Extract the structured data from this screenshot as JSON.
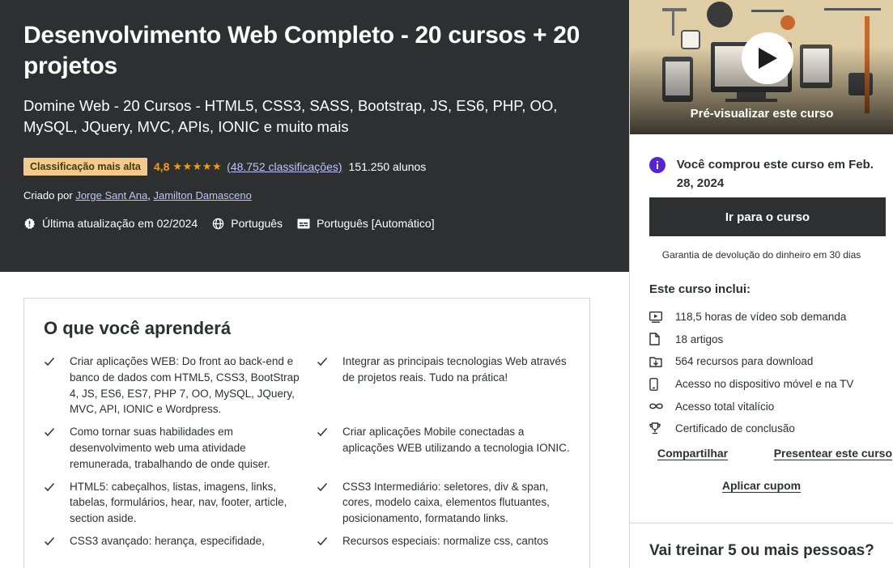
{
  "course": {
    "title": "Desenvolvimento Web Completo - 20 cursos + 20 projetos",
    "subtitle": "Domine Web - 20 Cursos - HTML5, CSS3, SASS, Bootstrap, JS, ES6, PHP, OO, MySQL, JQuery, MVC, APIs, IONIC e muito mais",
    "badge": "Classificação mais alta",
    "rating": "4,8",
    "stars": "★★★★★",
    "rating_count": "(48.752 classificações)",
    "students": "151.250 alunos",
    "created_by_label": "Criado por",
    "creators": [
      "Jorge Sant Ana",
      "Jamilton Damasceno"
    ],
    "creator_separator": ", ",
    "last_updated": "Última atualização em 02/2024",
    "language": "Português",
    "captions": "Português [Automático]"
  },
  "learn": {
    "title": "O que você aprenderá",
    "items": [
      "Criar aplicações WEB: Do front ao back-end e banco de dados com HTML5, CSS3, BootStrap 4, JS, ES6, ES7, PHP 7, OO, MySQL, JQuery, MVC, API, IONIC e Wordpress.",
      "Integrar as principais tecnologias Web através de projetos reais. Tudo na prática!",
      "Como tornar suas habilidades em desenvolvimento web uma atividade remunerada, trabalhando de onde quiser.",
      "Criar aplicações Mobile conectadas a aplicações WEB utilizando a tecnologia IONIC.",
      "HTML5: cabeçalhos, listas, imagens, links, tabelas, formulários, hear, nav, footer, article, section aside.",
      "CSS3 Intermediário: seletores, div & span, cores, modelo caixa, elementos flutuantes, posicionamento, formatando links.",
      "CSS3 avançado: herança, especifidade,",
      "Recursos especiais: normalize css, cantos"
    ]
  },
  "sidebar": {
    "preview_label": "Pré-visualizar este curso",
    "purchased_text": "Você comprou este curso em Feb. 28, 2024",
    "go_button": "Ir para o curso",
    "guarantee": "Garantia de devolução do dinheiro em 30 dias",
    "includes_title": "Este curso inclui:",
    "includes": [
      {
        "icon": "video-icon",
        "label": "118,5 horas de vídeo sob demanda"
      },
      {
        "icon": "file-icon",
        "label": "18 artigos"
      },
      {
        "icon": "download-icon",
        "label": "564 recursos para download"
      },
      {
        "icon": "mobile-icon",
        "label": "Acesso no dispositivo móvel e na TV"
      },
      {
        "icon": "infinity-icon",
        "label": "Acesso total vitalício"
      },
      {
        "icon": "trophy-icon",
        "label": "Certificado de conclusão"
      }
    ],
    "share": "Compartilhar",
    "gift": "Presentear este curso",
    "coupon": "Aplicar cupom",
    "teams_title": "Vai treinar 5 ou mais pessoas?"
  },
  "colors": {
    "hero_bg": "#2d2f31",
    "badge_bg": "#f3ca8c",
    "star": "#f69c08",
    "link_on_dark": "#c0c4fc",
    "info_purple": "#5624d0"
  }
}
